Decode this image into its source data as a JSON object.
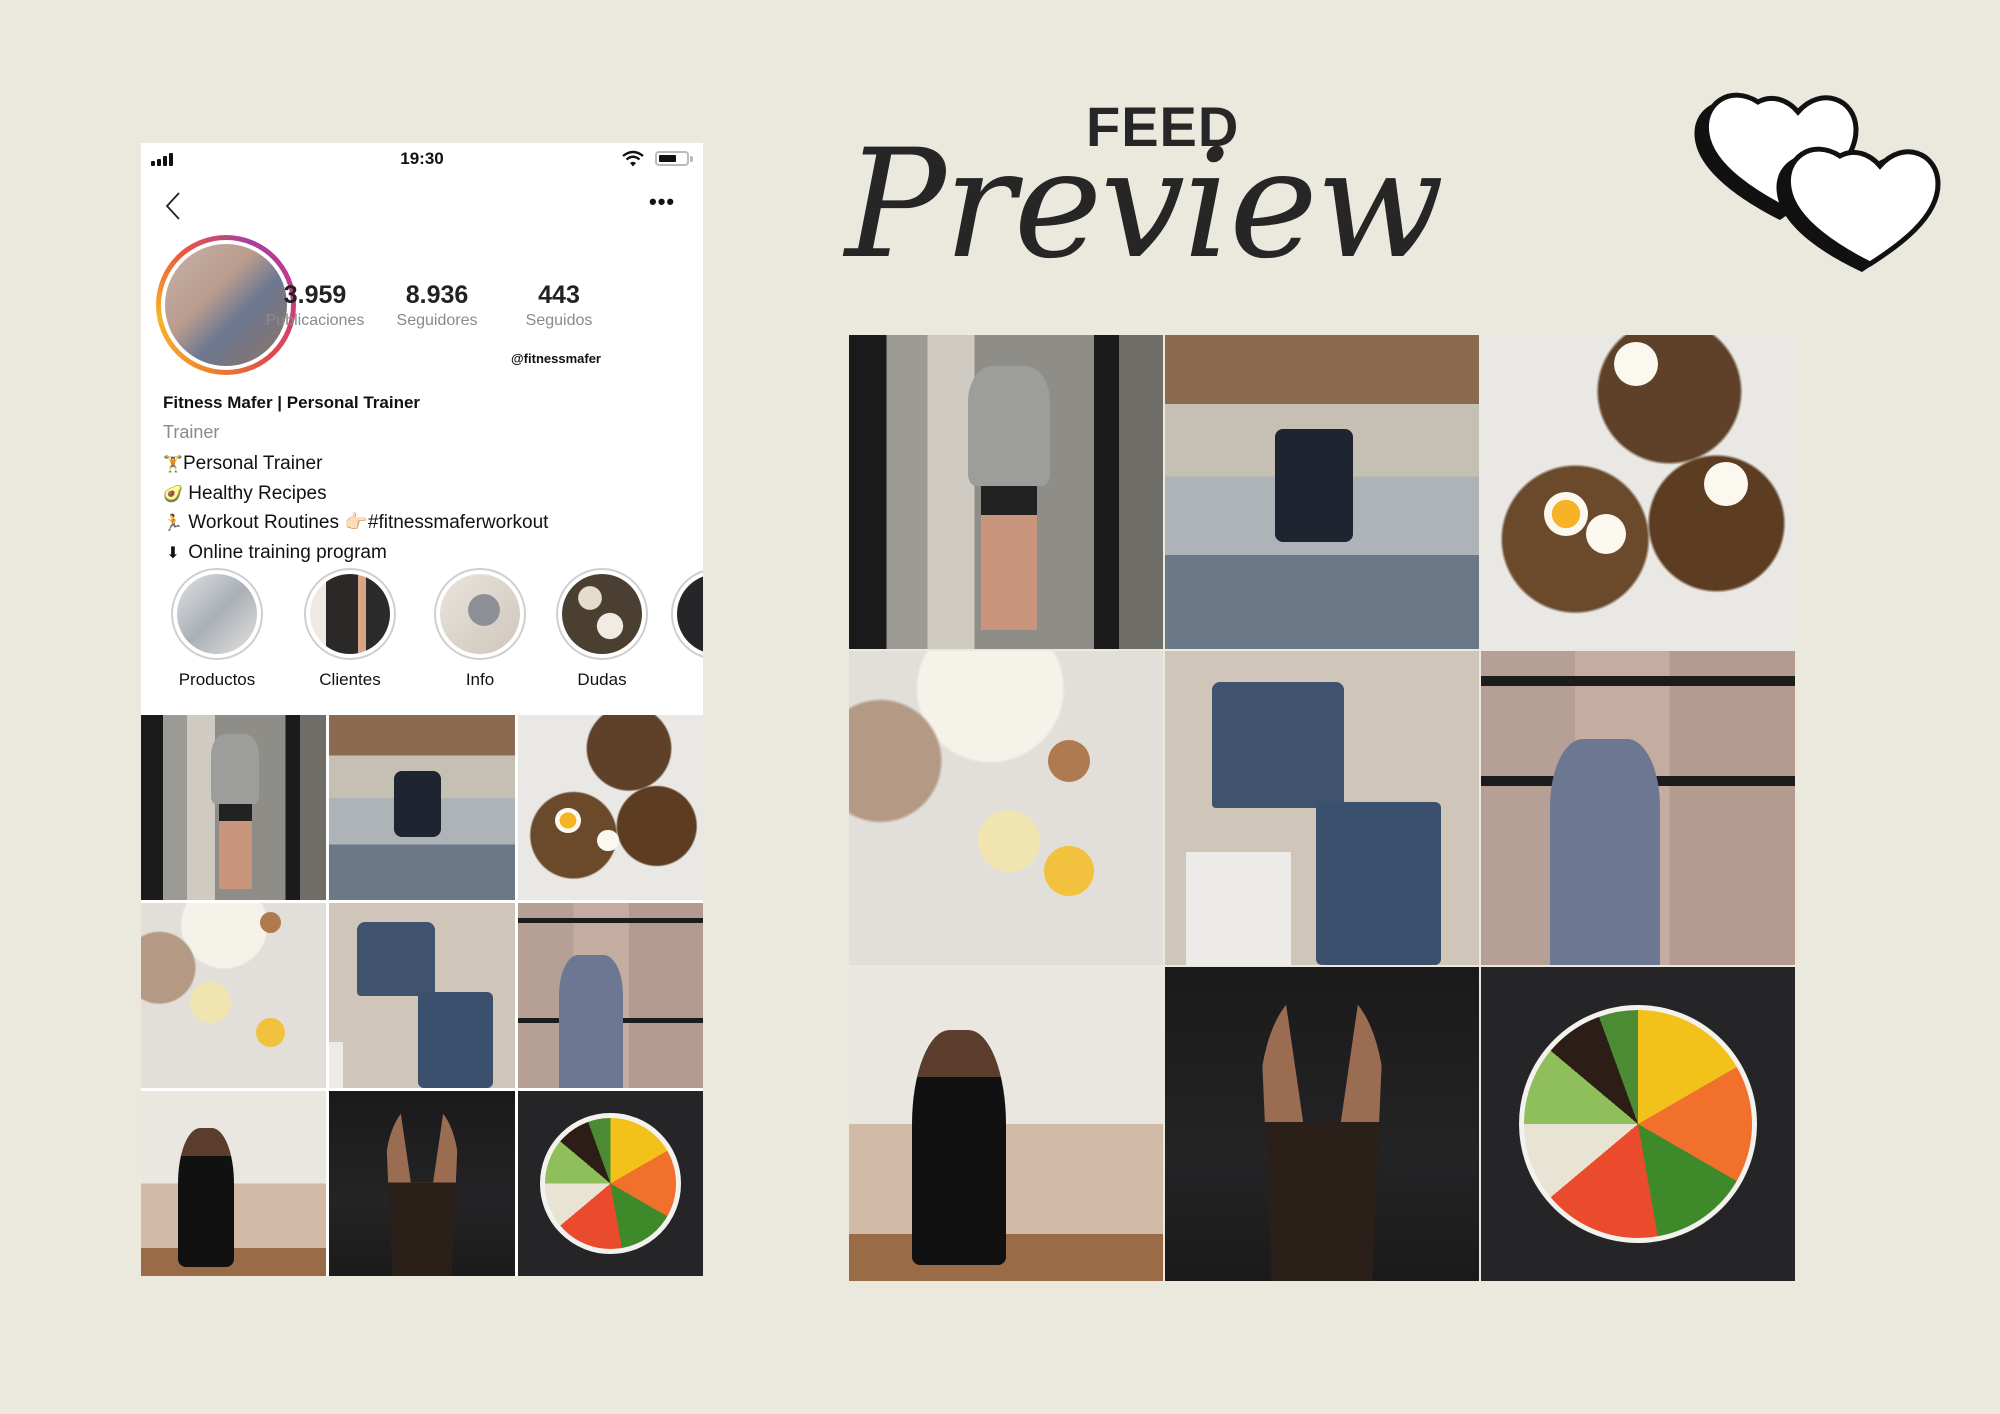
{
  "header": {
    "small_title": "FEED",
    "big_title": "Preview",
    "decoration_icon": "two-hearts-icon"
  },
  "phone": {
    "status_bar": {
      "time": "19:30",
      "signal_icon": "signal-bars-icon",
      "wifi_icon": "wifi-icon",
      "battery_icon": "battery-icon",
      "battery_level": 0.65
    },
    "nav": {
      "back_icon": "chevron-left-icon",
      "more_icon": "ellipsis-icon",
      "more_label": "•••"
    },
    "profile": {
      "handle": "@fitnessmafer",
      "name": "Fitness Mafer | Personal Trainer",
      "category": "Trainer",
      "stats": [
        {
          "value": "3.959",
          "label": "Publicaciones"
        },
        {
          "value": "8.936",
          "label": "Seguidores"
        },
        {
          "value": "443",
          "label": "Seguidos"
        }
      ],
      "bio": [
        {
          "emoji": "🏋",
          "text": "Personal Trainer"
        },
        {
          "emoji": "🥑",
          "text": "Healthy Recipes"
        },
        {
          "emoji": "🏃",
          "text": "Workout Routines 👉🏻#fitnessmaferworkout"
        },
        {
          "emoji": "⬇",
          "text": "Online training program"
        }
      ]
    },
    "highlights": [
      {
        "label": "Productos"
      },
      {
        "label": "Clientes"
      },
      {
        "label": "Info"
      },
      {
        "label": "Dudas"
      },
      {
        "label": ""
      }
    ]
  },
  "feed_posts": [
    {
      "subject": "gym mirror selfie"
    },
    {
      "subject": "leg press workout"
    },
    {
      "subject": "avocado egg toast"
    },
    {
      "subject": "baking ingredients"
    },
    {
      "subject": "activewear flat lay"
    },
    {
      "subject": "woman in gym bodysuit"
    },
    {
      "subject": "yoga stretch at home"
    },
    {
      "subject": "gymnastic rings hang"
    },
    {
      "subject": "vegetable bowl"
    }
  ]
}
